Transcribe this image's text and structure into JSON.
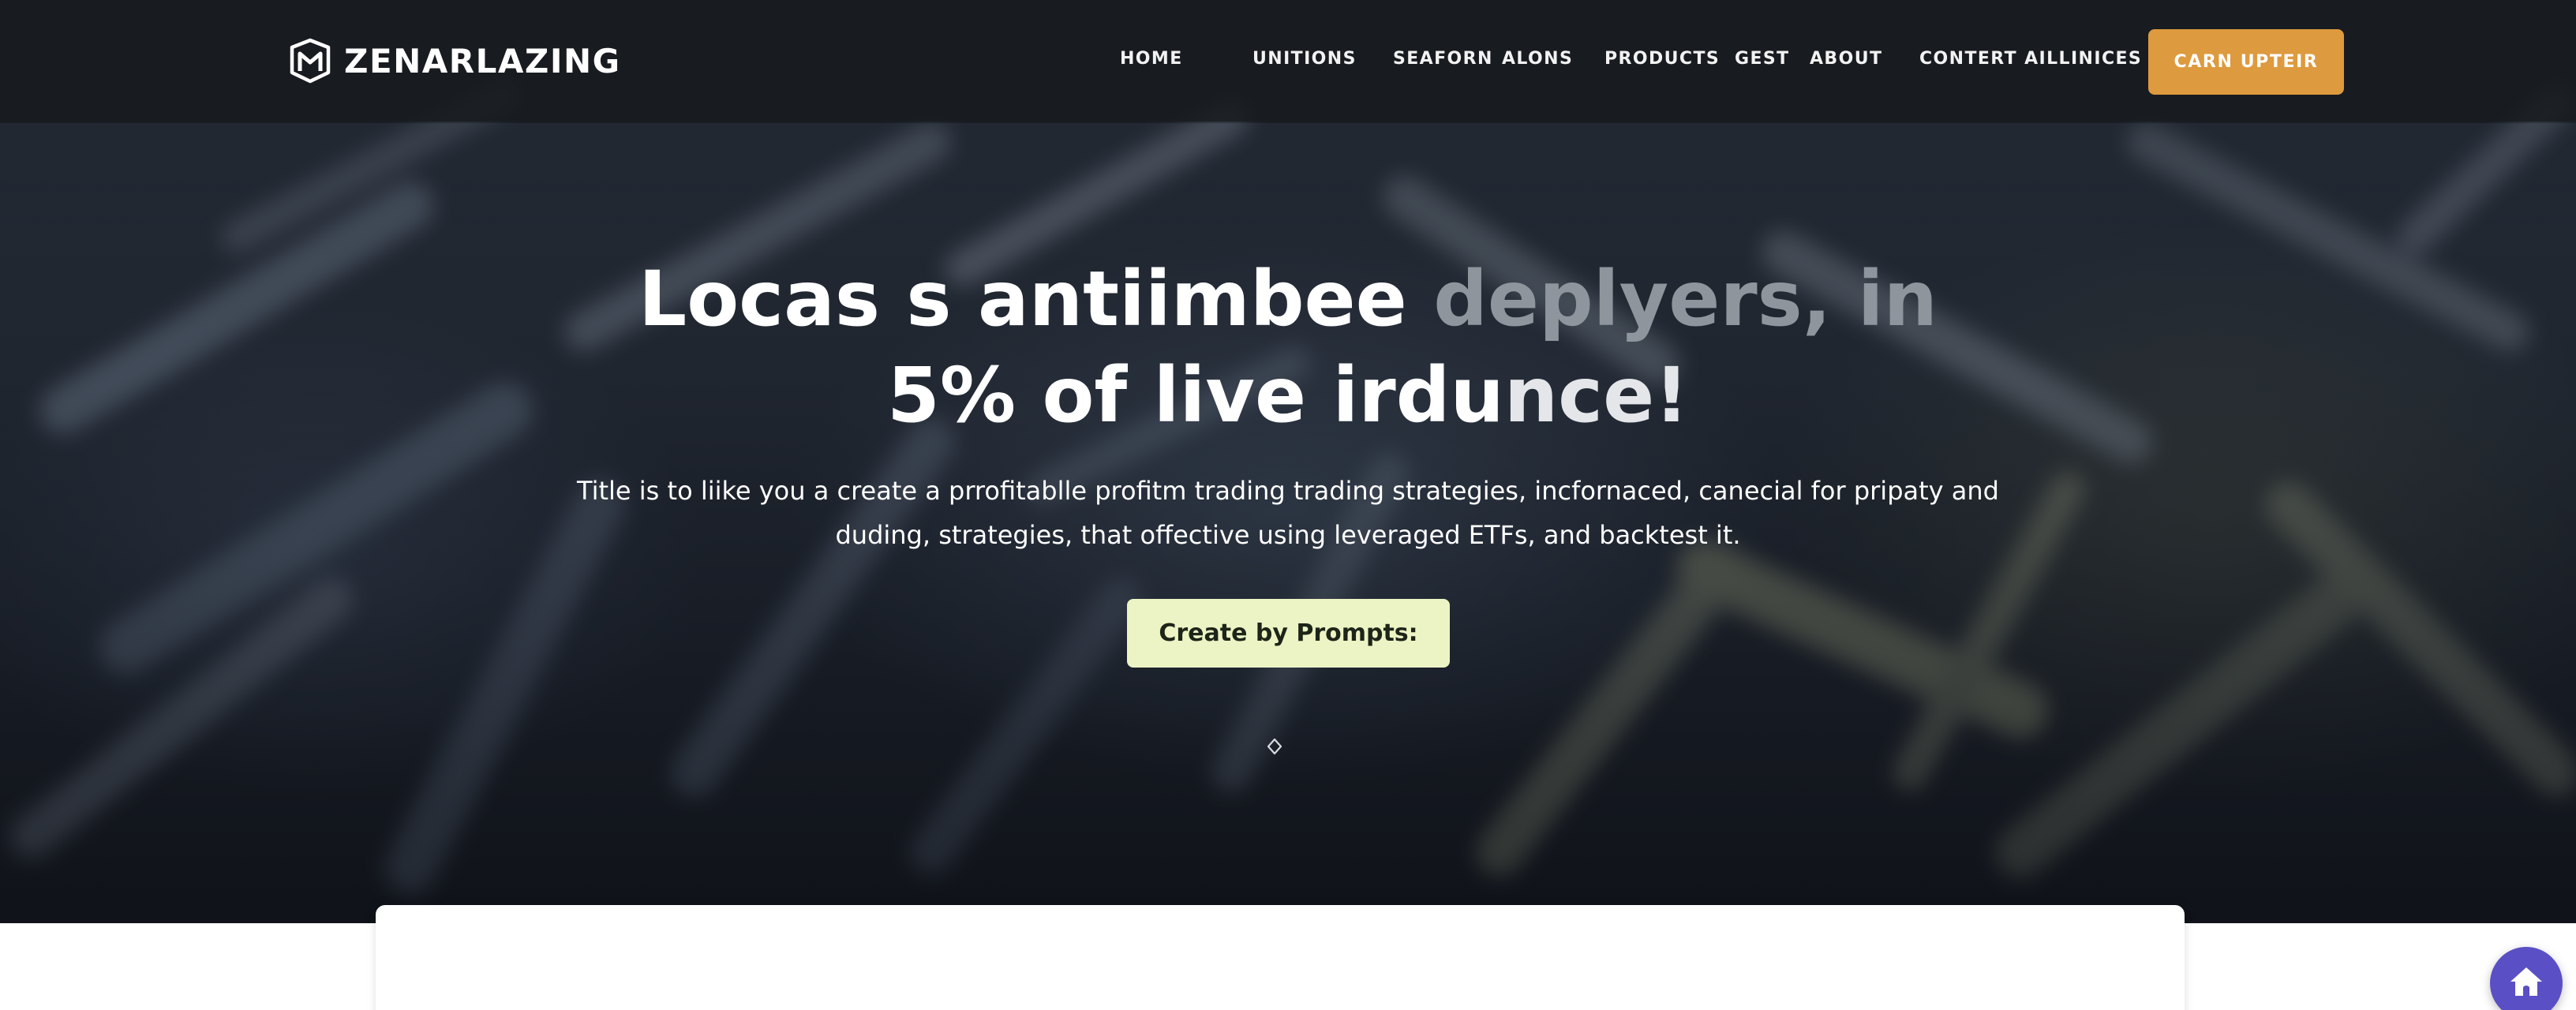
{
  "brand": {
    "name": "ZENARLAZING"
  },
  "nav": {
    "items": [
      {
        "label": "HOME"
      },
      {
        "label": "UNITIONS"
      },
      {
        "label": "SEAFORN"
      },
      {
        "label": "ALONS"
      },
      {
        "label": "PRODUCTS"
      },
      {
        "label": "GEST"
      },
      {
        "label": "ABOUT"
      },
      {
        "label": "CONTERT AILLINICES"
      }
    ],
    "cta_label": "CARN UPTEIR"
  },
  "hero": {
    "headline_part1": "Locas s antiimbee ",
    "headline_part1_dim": "deplyers, in",
    "headline_part2": "5% of live irdu",
    "headline_part2_dim": "nce!",
    "subtext": "Title is to liike you a create a prrofitablle profitm trading trading strategies, incfornaced, canecial for pripaty and duding, strategies, that offective using leveraged ETFs, and backtest it.",
    "cta_label": "Create by Prompts:"
  },
  "colors": {
    "nav_cta": "#de9a3e",
    "hero_cta": "#ecf4c5",
    "fab": "#5a4fc4",
    "headline_dim": "#8f959d"
  },
  "icons": {
    "logo": "shield-m-logo-icon",
    "scroll": "diamond-scroll-icon",
    "fab": "home-icon"
  }
}
